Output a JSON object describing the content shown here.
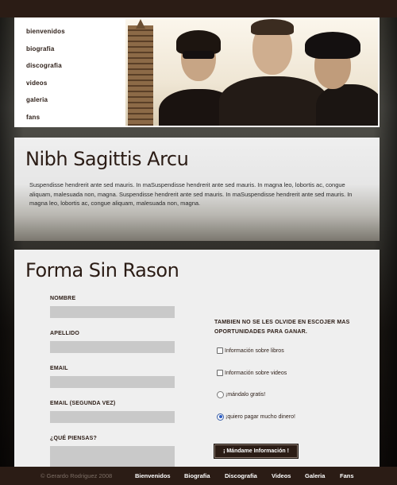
{
  "nav": {
    "items": [
      {
        "label": "bienvenidos"
      },
      {
        "label": "biografia"
      },
      {
        "label": "discografia"
      },
      {
        "label": "videos"
      },
      {
        "label": "galeria"
      },
      {
        "label": "fans"
      }
    ]
  },
  "article": {
    "title": "Nibh Sagittis Arcu",
    "body": "Suspendisse hendrerit ante sed mauris. In maSuspendisse hendrerit ante sed mauris. In magna leo, lobortis ac, congue aliquam, malesuada non, magna. Suspendisse hendrerit ante sed mauris. In maSuspendisse hendrerit ante sed mauris. In magna leo, lobortis ac, congue aliquam, malesuada non, magna."
  },
  "form": {
    "title": "Forma Sin Rason",
    "fields": {
      "nombre": "NOMBRE",
      "apellido": "APELLIDO",
      "email": "EMAIL",
      "email2": "EMAIL (SEGUNDA VEZ)",
      "piensas": "¿QUÉ PIENSAS?"
    },
    "aside_heading": "TAMBIEN NO SE LES OLVIDE EN ESCOJER MAS OPORTUNIDADES PARA GANAR.",
    "options": {
      "libros": "Información sobre libros",
      "videos": "Información sobre videos",
      "gratis": "¡mándalo gratis!",
      "dinero": "¡quiero pagar mucho dinero!"
    },
    "submit_label": "¡ Mándame Información !"
  },
  "footer": {
    "copyright": "© Gerardo Rodriguez 2008",
    "links": [
      "Bienvenidos",
      "Biografia",
      "Discografia",
      "Videos",
      "Galeria",
      "Fans"
    ]
  },
  "colors": {
    "brand_dark": "#2b1c15",
    "input_gray": "#c9c9c9",
    "radio_selected": "#2c5cc5"
  }
}
